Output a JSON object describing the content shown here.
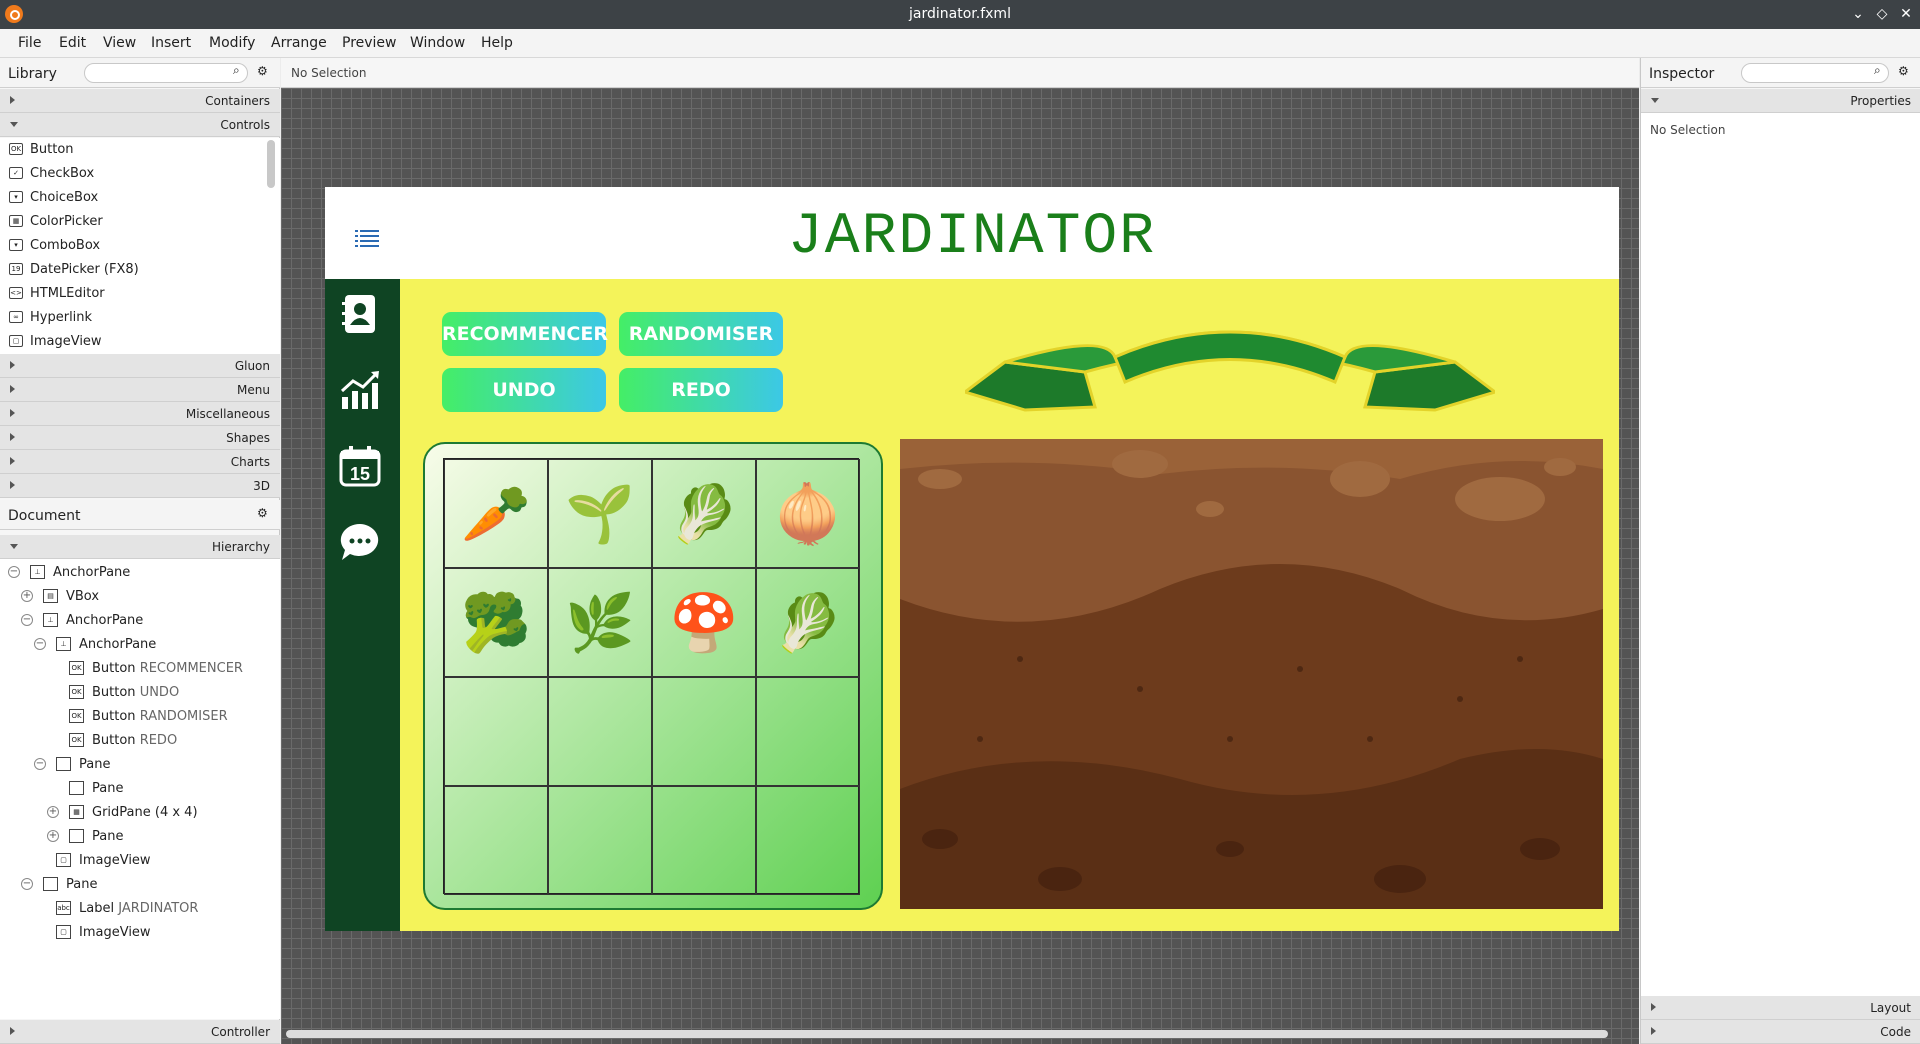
{
  "window": {
    "title": "jardinator.fxml"
  },
  "menu": [
    "File",
    "Edit",
    "View",
    "Insert",
    "Modify",
    "Arrange",
    "Preview",
    "Window",
    "Help"
  ],
  "library": {
    "title": "Library",
    "sections": [
      "Containers",
      "Controls",
      "Gluon",
      "Menu",
      "Miscellaneous",
      "Shapes",
      "Charts",
      "3D"
    ],
    "controls": [
      {
        "icon": "OK",
        "label": "Button"
      },
      {
        "icon": "✓",
        "label": "CheckBox"
      },
      {
        "icon": "▾",
        "label": "ChoiceBox"
      },
      {
        "icon": "▦",
        "label": "ColorPicker"
      },
      {
        "icon": "▾",
        "label": "ComboBox"
      },
      {
        "icon": "19",
        "label": "DatePicker  (FX8)"
      },
      {
        "icon": "<>",
        "label": "HTMLEditor"
      },
      {
        "icon": "∞",
        "label": "Hyperlink"
      },
      {
        "icon": "▢",
        "label": "ImageView"
      }
    ]
  },
  "document": {
    "title": "Document",
    "section": "Hierarchy",
    "tree": [
      {
        "label": "AnchorPane",
        "value": ""
      },
      {
        "label": "VBox",
        "value": ""
      },
      {
        "label": "AnchorPane",
        "value": ""
      },
      {
        "label": "AnchorPane",
        "value": ""
      },
      {
        "label": "Button",
        "value": "RECOMMENCER"
      },
      {
        "label": "Button",
        "value": "UNDO"
      },
      {
        "label": "Button",
        "value": "RANDOMISER"
      },
      {
        "label": "Button",
        "value": "REDO"
      },
      {
        "label": "Pane",
        "value": ""
      },
      {
        "label": "Pane",
        "value": ""
      },
      {
        "label": "GridPane (4 x 4)",
        "value": ""
      },
      {
        "label": "Pane",
        "value": ""
      },
      {
        "label": "ImageView",
        "value": ""
      },
      {
        "label": "Pane",
        "value": ""
      },
      {
        "label": "Label",
        "value": "JARDINATOR"
      },
      {
        "label": "ImageView",
        "value": ""
      }
    ],
    "controller": "Controller"
  },
  "canvas": {
    "selection": "No Selection"
  },
  "inspector": {
    "title": "Inspector",
    "section": "Properties",
    "selection": "No Selection",
    "layout": "Layout",
    "code": "Code"
  },
  "app": {
    "title": "JARDINATOR",
    "buttons": {
      "restart": "RECOMMENCER",
      "randomize": "RANDOMISER",
      "undo": "UNDO",
      "redo": "REDO"
    },
    "vegetables": [
      "🥕",
      "🌱",
      "🥬",
      "🧅",
      "🥦",
      "🌿",
      "🍄",
      "🥬"
    ],
    "colors": {
      "background": "#f4f35a",
      "title": "#1a7f1a",
      "sidebar": "#0f4423",
      "soil": "#6b3a1e"
    }
  }
}
